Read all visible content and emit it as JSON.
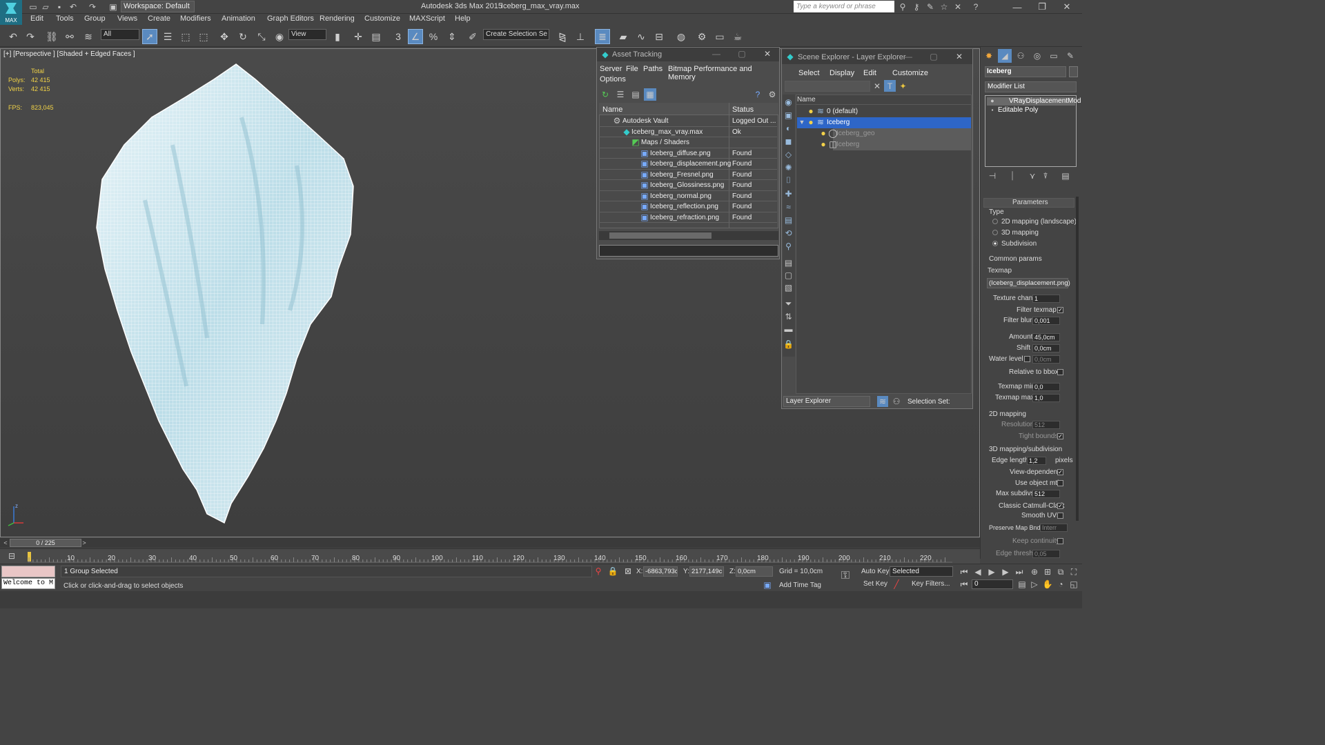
{
  "titlebar": {
    "workspace": "Workspace: Default",
    "app": "Autodesk 3ds Max  2015",
    "file": "Iceberg_max_vray.max",
    "search_placeholder": "Type a keyword or phrase",
    "logo": "MAX"
  },
  "menu": [
    "Edit",
    "Tools",
    "Group",
    "Views",
    "Create",
    "Modifiers",
    "Animation",
    "Graph Editors",
    "Rendering",
    "Customize",
    "MAXScript",
    "Help"
  ],
  "toolbar": {
    "filter": "All",
    "ref_coord": "View",
    "selection_set": "Create Selection Se"
  },
  "viewport": {
    "label": "[+] [Perspective ] [Shaded + Edged Faces ]",
    "stats": {
      "total_label": "Total",
      "polys_label": "Polys:",
      "polys": "42 415",
      "verts_label": "Verts:",
      "verts": "42 415",
      "fps_label": "FPS:",
      "fps": "823,045"
    },
    "axis_z": "z"
  },
  "asset_tracking": {
    "title": "Asset Tracking",
    "menu": [
      "Server",
      "File",
      "Paths",
      "Bitmap Performance and Memory",
      "Options"
    ],
    "columns": [
      "Name",
      "Status"
    ],
    "rows": [
      {
        "name": "Autodesk Vault",
        "status": "Logged Out ...",
        "indent": 0
      },
      {
        "name": "Iceberg_max_vray.max",
        "status": "Ok",
        "indent": 1
      },
      {
        "name": "Maps / Shaders",
        "status": "",
        "indent": 2
      },
      {
        "name": "Iceberg_diffuse.png",
        "status": "Found",
        "indent": 3
      },
      {
        "name": "Iceberg_displacement.png",
        "status": "Found",
        "indent": 3
      },
      {
        "name": "Iceberg_Fresnel.png",
        "status": "Found",
        "indent": 3
      },
      {
        "name": "Iceberg_Glossiness.png",
        "status": "Found",
        "indent": 3
      },
      {
        "name": "Iceberg_normal.png",
        "status": "Found",
        "indent": 3
      },
      {
        "name": "Iceberg_reflection.png",
        "status": "Found",
        "indent": 3
      },
      {
        "name": "Iceberg_refraction.png",
        "status": "Found",
        "indent": 3
      }
    ]
  },
  "scene_explorer": {
    "title": "Scene Explorer - Layer Explorer",
    "menu": [
      "Select",
      "Display",
      "Edit",
      "Customize"
    ],
    "column": "Name",
    "items": [
      {
        "name": "0 (default)",
        "level": 0,
        "selected": false,
        "dim": false
      },
      {
        "name": "Iceberg",
        "level": 0,
        "selected": true,
        "dim": false
      },
      {
        "name": "Iceberg_geo",
        "level": 1,
        "selected": false,
        "dim": true
      },
      {
        "name": "Iceberg",
        "level": 1,
        "selected": false,
        "dim": true
      }
    ],
    "footer_dropdown": "Layer Explorer",
    "selection_set": "Selection Set:"
  },
  "command_panel": {
    "object_name": "Iceberg",
    "modifier_list": "Modifier List",
    "stack": [
      "VRayDisplacementMod",
      "Editable Poly"
    ],
    "rollout": "Parameters",
    "type_label": "Type",
    "types": [
      "2D mapping (landscape)",
      "3D mapping",
      "Subdivision"
    ],
    "common_params": "Common params",
    "texmap_label": "Texmap",
    "texmap": "(Iceberg_displacement.png)",
    "texture_chan_label": "Texture chan",
    "texture_chan": "1",
    "filter_texmap_label": "Filter texmap",
    "filter_blur_label": "Filter blur",
    "filter_blur": "0,001",
    "amount_label": "Amount",
    "amount": "45,0cm",
    "shift_label": "Shift",
    "shift": "0,0cm",
    "water_label": "Water level",
    "water": "0,0cm",
    "relative_label": "Relative to bbox",
    "texmap_min_label": "Texmap min",
    "texmap_min": "0,0",
    "texmap_max_label": "Texmap max",
    "texmap_max": "1,0",
    "mapping2d": "2D mapping",
    "resolution_label": "Resolution",
    "resolution": "512",
    "tight_label": "Tight bounds",
    "mapping3d": "3D mapping/subdivision",
    "edge_length_label": "Edge length",
    "edge_length": "1,2",
    "pixels": "pixels",
    "view_dep_label": "View-dependent",
    "use_obj_label": "Use object mtl",
    "max_subdivs_label": "Max subdivs",
    "max_subdivs": "512",
    "catmull_label": "Classic Catmull-Clark",
    "smooth_uvs_label": "Smooth UVs",
    "preserve_label": "Preserve Map Bnd",
    "preserve": "Interr",
    "keep_label": "Keep continuity",
    "edge_thresh_label": "Edge thresh",
    "edge_thresh": "0,05"
  },
  "timeline": {
    "frame": "0 / 225",
    "ticks": [
      "10",
      "20",
      "30",
      "40",
      "50",
      "60",
      "70",
      "80",
      "90",
      "100",
      "110",
      "120",
      "130",
      "140",
      "150",
      "160",
      "170",
      "180",
      "190",
      "200",
      "210",
      "220"
    ]
  },
  "status": {
    "welcome": "Welcome to M",
    "selected": "1 Group Selected",
    "prompt": "Click or click-and-drag to select objects",
    "x_label": "X:",
    "x": "-6863,793c",
    "y_label": "Y:",
    "y": "2177,149c",
    "z_label": "Z:",
    "z": "0,0cm",
    "grid": "Grid = 10,0cm",
    "add_time_tag": "Add Time Tag",
    "auto_key": "Auto Key",
    "selected_dd": "Selected",
    "set_key": "Set Key",
    "key_filters": "Key Filters...",
    "frame_num": "0"
  }
}
